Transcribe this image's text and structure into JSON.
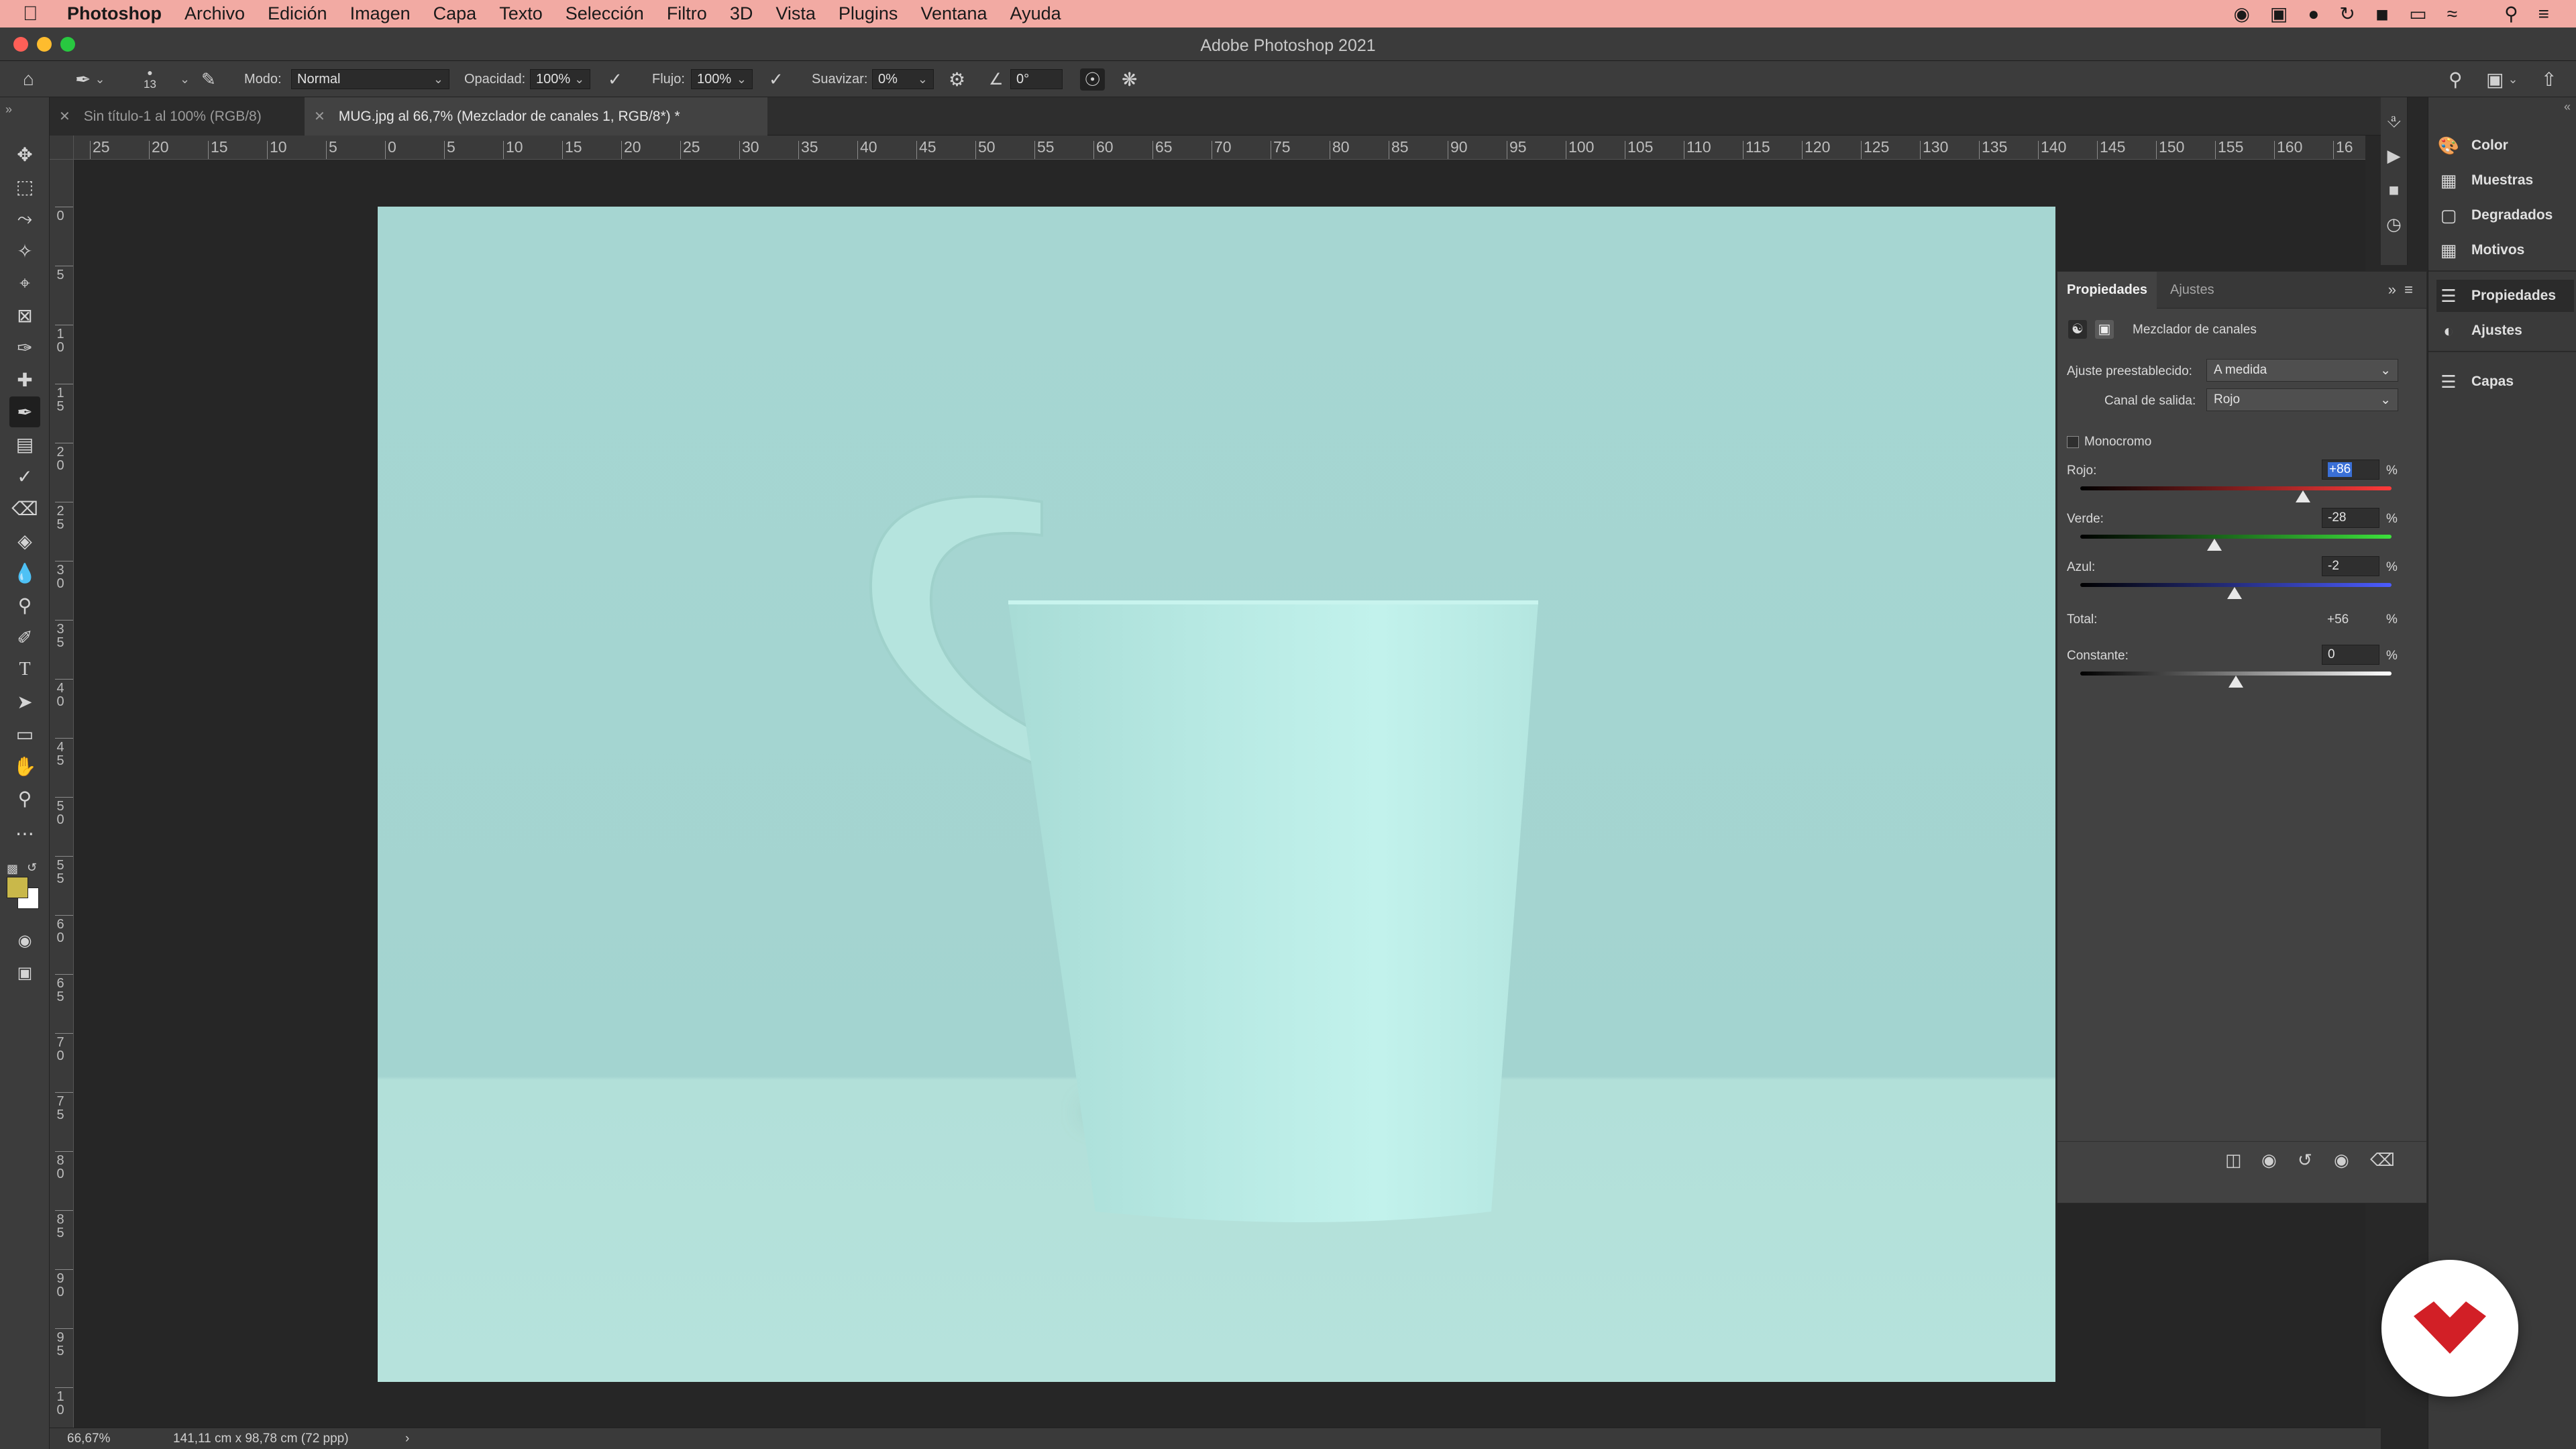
{
  "menubar": {
    "app_name": "Photoshop",
    "items": [
      "Archivo",
      "Edición",
      "Imagen",
      "Capa",
      "Texto",
      "Selección",
      "Filtro",
      "3D",
      "Vista",
      "Plugins",
      "Ventana",
      "Ayuda"
    ]
  },
  "window": {
    "title": "Adobe Photoshop 2021"
  },
  "options_bar": {
    "brush_size": "13",
    "mode_label": "Modo:",
    "mode_value": "Normal",
    "opacity_label": "Opacidad:",
    "opacity_value": "100%",
    "flow_label": "Flujo:",
    "flow_value": "100%",
    "smooth_label": "Suavizar:",
    "smooth_value": "0%",
    "angle_value": "0°"
  },
  "tabs": [
    {
      "label": "Sin título-1 al 100% (RGB/8)"
    },
    {
      "label": "MUG.jpg al 66,7% (Mezclador de canales 1, RGB/8*) *"
    }
  ],
  "ruler_h": [
    "25",
    "20",
    "15",
    "10",
    "5",
    "0",
    "5",
    "10",
    "15",
    "20",
    "25",
    "30",
    "35",
    "40",
    "45",
    "50",
    "55",
    "60",
    "65",
    "70",
    "75",
    "80",
    "85",
    "90",
    "95",
    "100",
    "105",
    "110",
    "115",
    "120",
    "125",
    "130",
    "135",
    "140",
    "145",
    "150",
    "155",
    "160",
    "16"
  ],
  "ruler_v": [
    "0",
    "5",
    "1\n0",
    "1\n5",
    "2\n0",
    "2\n5",
    "3\n0",
    "3\n5",
    "4\n0",
    "4\n5",
    "5\n0",
    "5\n5",
    "6\n0",
    "6\n5",
    "7\n0",
    "7\n5",
    "8\n0",
    "8\n5",
    "9\n0",
    "9\n5",
    "1\n0"
  ],
  "properties": {
    "tab_active": "Propiedades",
    "tab_inactive": "Ajustes",
    "layer_name": "Mezclador de canales",
    "preset_label": "Ajuste preestablecido:",
    "preset_value": "A medida",
    "output_label": "Canal de salida:",
    "output_value": "Rojo",
    "mono_label": "Monocromo",
    "red_label": "Rojo:",
    "red_value": "+86",
    "red_level": 86,
    "green_label": "Verde:",
    "green_value": "-28",
    "green_level": -28,
    "blue_label": "Azul:",
    "blue_value": "-2",
    "blue_level": -2,
    "total_label": "Total:",
    "total_value": "+56",
    "constant_label": "Constante:",
    "constant_value": "0",
    "constant_level": 0,
    "percent": "%"
  },
  "dock": {
    "items": [
      "Color",
      "Muestras",
      "Degradados",
      "Motivos",
      "Propiedades",
      "Ajustes",
      "Capas"
    ]
  },
  "status": {
    "zoom": "66,67%",
    "doc_size": "141,11 cm x 98,78 cm (72 ppp)",
    "arrow": "›"
  },
  "colors": {
    "foreground": "#c9b84a",
    "background": "#ffffff",
    "brand_red": "#d21f26"
  }
}
